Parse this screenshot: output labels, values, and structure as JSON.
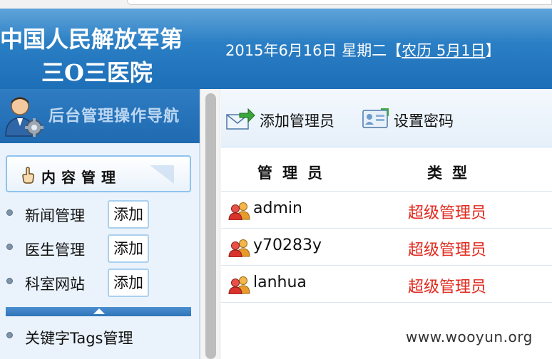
{
  "header": {
    "hospital_line1": "中国人民解放军第",
    "hospital_line2": "三O三医院",
    "date_prefix": "2015年6月16日 星期二【",
    "lunar_link": "农历 5月1日",
    "date_suffix": "】"
  },
  "sidebar": {
    "title": "后台管理操作导航",
    "section_label": "内容管理",
    "items": [
      {
        "label": "新闻管理",
        "action": "添加"
      },
      {
        "label": "医生管理",
        "action": "添加"
      },
      {
        "label": "科室网站",
        "action": "添加"
      },
      {
        "label": "关键字Tags管理"
      }
    ]
  },
  "toolbar": {
    "add_admin": "添加管理员",
    "set_password": "设置密码"
  },
  "table": {
    "columns": [
      "管理员",
      "类型"
    ],
    "rows": [
      {
        "name": "admin",
        "type": "超级管理员"
      },
      {
        "name": "y70283y",
        "type": "超级管理员"
      },
      {
        "name": "lanhua",
        "type": "超级管理员"
      }
    ]
  },
  "watermark": "www.wooyun.org",
  "colors": {
    "header_blue": "#2a7ec4",
    "accent_red": "#e0291d",
    "sidebar_bg": "#eaf3fc"
  }
}
